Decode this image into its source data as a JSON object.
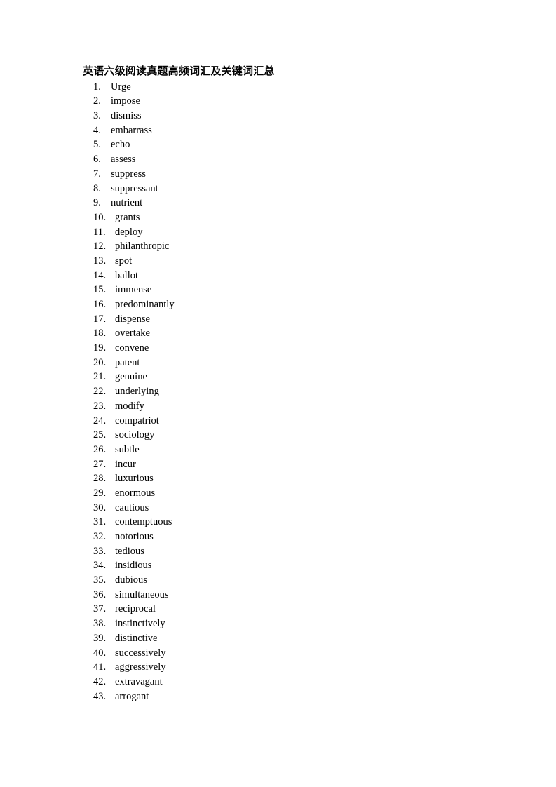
{
  "document": {
    "title": "英语六级阅读真题高频词汇及关键词汇总",
    "page_background": "#ffffff",
    "text_color": "#000000"
  },
  "vocabulary": [
    {
      "number": "1.",
      "word": "Urge"
    },
    {
      "number": "2.",
      "word": "impose"
    },
    {
      "number": "3.",
      "word": "dismiss"
    },
    {
      "number": "4.",
      "word": "embarrass"
    },
    {
      "number": "5.",
      "word": "echo"
    },
    {
      "number": "6.",
      "word": "assess"
    },
    {
      "number": "7.",
      "word": "suppress"
    },
    {
      "number": "8.",
      "word": "suppressant"
    },
    {
      "number": "9.",
      "word": "nutrient"
    },
    {
      "number": "10.",
      "word": "grants"
    },
    {
      "number": "11.",
      "word": "deploy"
    },
    {
      "number": "12.",
      "word": "philanthropic"
    },
    {
      "number": "13.",
      "word": "spot"
    },
    {
      "number": "14.",
      "word": "ballot"
    },
    {
      "number": "15.",
      "word": "immense"
    },
    {
      "number": "16.",
      "word": "predominantly"
    },
    {
      "number": "17.",
      "word": "dispense"
    },
    {
      "number": "18.",
      "word": "overtake"
    },
    {
      "number": "19.",
      "word": "convene"
    },
    {
      "number": "20.",
      "word": "patent"
    },
    {
      "number": "21.",
      "word": "genuine"
    },
    {
      "number": "22.",
      "word": "underlying"
    },
    {
      "number": "23.",
      "word": "modify"
    },
    {
      "number": "24.",
      "word": "compatriot"
    },
    {
      "number": "25.",
      "word": "sociology"
    },
    {
      "number": "26.",
      "word": "subtle"
    },
    {
      "number": "27.",
      "word": "incur"
    },
    {
      "number": "28.",
      "word": "luxurious"
    },
    {
      "number": "29.",
      "word": "enormous"
    },
    {
      "number": "30.",
      "word": "cautious"
    },
    {
      "number": "31.",
      "word": "contemptuous"
    },
    {
      "number": "32.",
      "word": "notorious"
    },
    {
      "number": "33.",
      "word": "tedious"
    },
    {
      "number": "34.",
      "word": "insidious"
    },
    {
      "number": "35.",
      "word": "dubious"
    },
    {
      "number": "36.",
      "word": "simultaneous"
    },
    {
      "number": "37.",
      "word": "reciprocal"
    },
    {
      "number": "38.",
      "word": "instinctively"
    },
    {
      "number": "39.",
      "word": "distinctive"
    },
    {
      "number": "40.",
      "word": "successively"
    },
    {
      "number": "41.",
      "word": "aggressively"
    },
    {
      "number": "42.",
      "word": "extravagant"
    },
    {
      "number": "43.",
      "word": "arrogant"
    }
  ]
}
